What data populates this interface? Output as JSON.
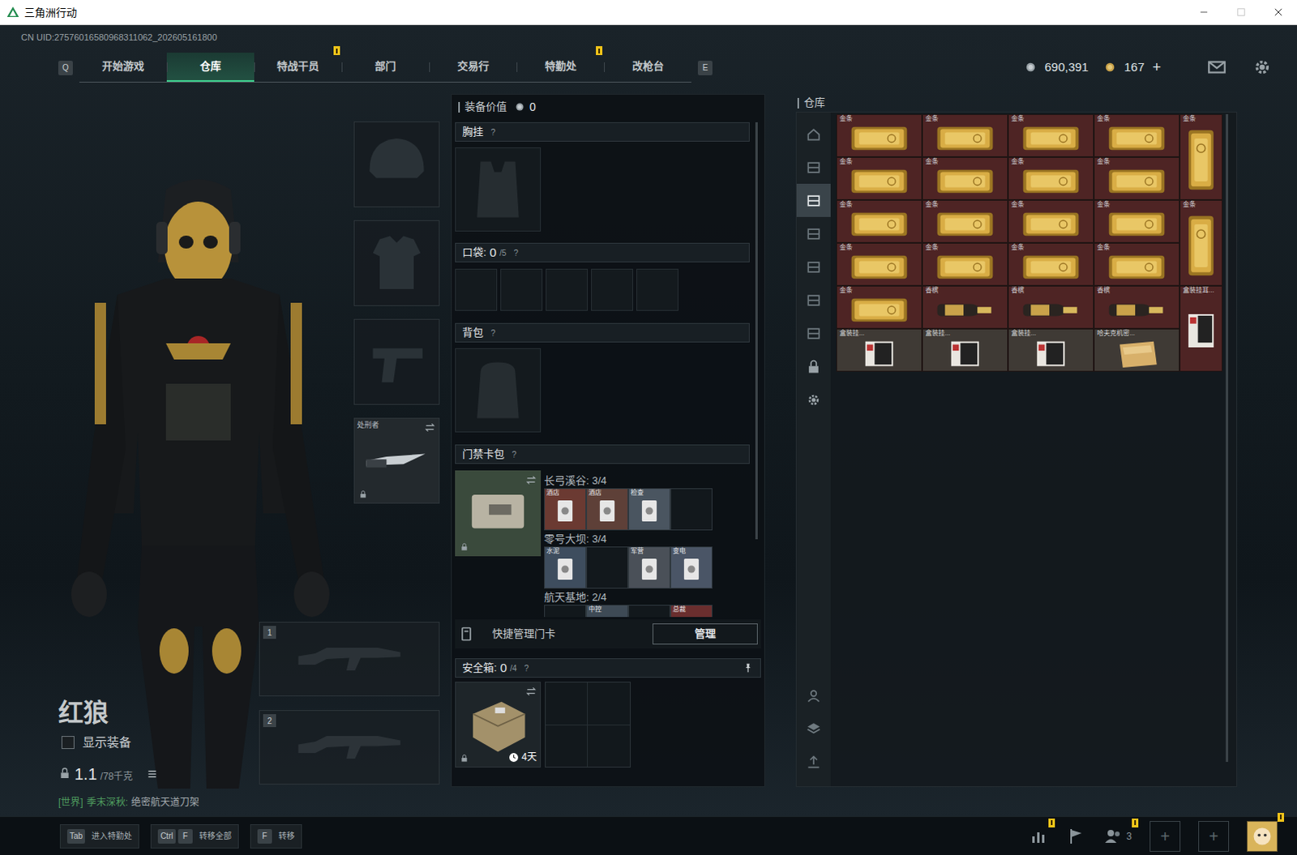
{
  "window": {
    "title": "三角洲行动"
  },
  "account": {
    "uid": "CN UID:27576016580968311062_202605161800"
  },
  "nav": {
    "prev_key": "Q",
    "next_key": "E",
    "tabs": [
      {
        "label": "开始游戏",
        "selected": false,
        "alert": false
      },
      {
        "label": "仓库",
        "selected": true,
        "alert": false
      },
      {
        "label": "特战干员",
        "selected": false,
        "alert": true
      },
      {
        "label": "部门",
        "selected": false,
        "alert": false
      },
      {
        "label": "交易行",
        "selected": false,
        "alert": false
      },
      {
        "label": "特勤处",
        "selected": false,
        "alert": true
      },
      {
        "label": "改枪台",
        "selected": false,
        "alert": false
      }
    ]
  },
  "currency": {
    "coins": "690,391",
    "tickets": "167",
    "add": "+"
  },
  "operator": {
    "name": "红狼",
    "show_gear": {
      "label": "显示装备",
      "checked": false
    },
    "weight": "1.1",
    "capacity": "/78千克"
  },
  "chat": {
    "channel": "[世界]",
    "sender": "季末深秋:",
    "message": "绝密航天道刀架"
  },
  "gear_slots": [
    {
      "kind": "helmet",
      "locked": false
    },
    {
      "kind": "armor",
      "locked": false
    },
    {
      "kind": "pistol",
      "locked": false
    },
    {
      "kind": "melee",
      "label": "处刑者",
      "locked": true
    }
  ],
  "weapon_slots": [
    {
      "number": "1"
    },
    {
      "number": "2"
    }
  ],
  "loadout": {
    "value_label": "装备价值",
    "value": "0",
    "chest_rig": {
      "title": "胸挂",
      "help": "?"
    },
    "pockets": {
      "title": "口袋:",
      "count": "0",
      "capacity": "/5",
      "help": "?",
      "slots": [
        {
          "filled": false
        },
        {
          "filled": false
        },
        {
          "filled": false
        },
        {
          "filled": false
        },
        {
          "filled": false
        }
      ]
    },
    "backpack": {
      "title": "背包",
      "help": "?"
    },
    "keycard_bag": {
      "title": "门禁卡包",
      "help": "?",
      "locked": true,
      "maps": [
        {
          "label": "长弓溪谷: 3/4",
          "cards": [
            {
              "filled": true,
              "label": "酒店",
              "color": "#6b3a32"
            },
            {
              "filled": true,
              "label": "酒店",
              "color": "#5e4038"
            },
            {
              "filled": true,
              "label": "检查",
              "color": "#4a5560"
            },
            {
              "filled": false
            }
          ]
        },
        {
          "label": "零号大坝: 3/4",
          "cards": [
            {
              "filled": true,
              "label": "水泥",
              "color": "#3e4d5e"
            },
            {
              "filled": false
            },
            {
              "filled": true,
              "label": "军营",
              "color": "#4a5058"
            },
            {
              "filled": true,
              "label": "变电",
              "color": "#4a5566"
            }
          ]
        },
        {
          "label": "航天基地: 2/4",
          "cards": [
            {
              "filled": false
            },
            {
              "filled": true,
              "label": "中控",
              "color": "#3e4a55"
            },
            {
              "filled": false
            },
            {
              "filled": true,
              "label": "总裁",
              "color": "#6a2e2e"
            }
          ]
        }
      ]
    },
    "quick_manage": {
      "label": "快捷管理门卡",
      "button": "管理"
    },
    "safe_box": {
      "title": "安全箱:",
      "count": "0",
      "capacity": "/4",
      "help": "?",
      "timer": "4天",
      "locked": true,
      "pinned": true
    }
  },
  "warehouse": {
    "title": "仓库",
    "sidebar": [
      {
        "kind": "home",
        "selected": false
      },
      {
        "kind": "storage",
        "selected": false
      },
      {
        "kind": "storage",
        "selected": true
      },
      {
        "kind": "storage",
        "selected": false
      },
      {
        "kind": "storage",
        "selected": false
      },
      {
        "kind": "storage",
        "selected": false
      },
      {
        "kind": "storage",
        "selected": false
      },
      {
        "kind": "lock",
        "selected": false
      },
      {
        "kind": "settings",
        "selected": false
      }
    ],
    "sidebar_bottom": [
      {
        "kind": "operator",
        "selected": false
      },
      {
        "kind": "layers",
        "selected": false
      },
      {
        "kind": "upload",
        "selected": false
      }
    ],
    "items": [
      {
        "label": "金条",
        "kind": "gold-bar",
        "color": "#4e2424"
      },
      {
        "label": "金条",
        "kind": "gold-bar",
        "color": "#4e2424"
      },
      {
        "label": "金条",
        "kind": "gold-bar",
        "color": "#4e2424"
      },
      {
        "label": "金条",
        "kind": "gold-bar",
        "color": "#4e2424"
      },
      {
        "label": "金条",
        "kind": "gold-bar-tall",
        "color": "#4e2424"
      },
      {
        "label": "金条",
        "kind": "gold-bar",
        "color": "#4e2424"
      },
      {
        "label": "金条",
        "kind": "gold-bar",
        "color": "#4e2424"
      },
      {
        "label": "金条",
        "kind": "gold-bar",
        "color": "#4e2424"
      },
      {
        "label": "金条",
        "kind": "gold-bar",
        "color": "#4e2424"
      },
      {
        "label": "金条",
        "kind": "gold-bar",
        "color": "#4e2424"
      },
      {
        "label": "金条",
        "kind": "gold-bar",
        "color": "#4e2424"
      },
      {
        "label": "金条",
        "kind": "gold-bar",
        "color": "#4e2424"
      },
      {
        "label": "金条",
        "kind": "gold-bar",
        "color": "#4e2424"
      },
      {
        "label": "金条",
        "kind": "gold-bar-tall",
        "color": "#4e2424"
      },
      {
        "label": "金条",
        "kind": "gold-bar",
        "color": "#4e2424"
      },
      {
        "label": "金条",
        "kind": "gold-bar",
        "color": "#4e2424"
      },
      {
        "label": "金条",
        "kind": "gold-bar",
        "color": "#4e2424"
      },
      {
        "label": "金条",
        "kind": "gold-bar",
        "color": "#4e2424"
      },
      {
        "label": "金条",
        "kind": "gold-bar",
        "color": "#4e2424"
      },
      {
        "label": "香槟",
        "kind": "champagne",
        "color": "#4e2424"
      },
      {
        "label": "香槟",
        "kind": "champagne",
        "color": "#4e2424"
      },
      {
        "label": "香槟",
        "kind": "champagne",
        "color": "#4e2424"
      },
      {
        "label": "盒装挂耳...",
        "kind": "coffee-box-tall",
        "color": "#4e2424"
      },
      {
        "label": "盒装挂...",
        "kind": "coffee-box",
        "color": "#3f3a35"
      },
      {
        "label": "盒装挂...",
        "kind": "coffee-box",
        "color": "#3f3a35"
      },
      {
        "label": "盒装挂...",
        "kind": "coffee-box",
        "color": "#3f3a35"
      },
      {
        "label": "哈夫克机密...",
        "kind": "document",
        "color": "#3f3a35"
      }
    ]
  },
  "bottom_bar": {
    "hints": [
      {
        "keys": [
          "Tab"
        ],
        "label": "进入特勤处"
      },
      {
        "keys": [
          "Ctrl",
          "F"
        ],
        "label": "转移全部"
      },
      {
        "keys": [
          "F"
        ],
        "label": "转移"
      }
    ],
    "tools": [
      {
        "kind": "stats",
        "alert": true
      },
      {
        "kind": "flag",
        "alert": false
      },
      {
        "kind": "friends",
        "count": "3",
        "alert": true
      },
      {
        "kind": "add",
        "label": "+",
        "alert": false
      },
      {
        "kind": "add",
        "label": "+",
        "alert": false
      },
      {
        "kind": "avatar",
        "alert": true
      }
    ]
  }
}
